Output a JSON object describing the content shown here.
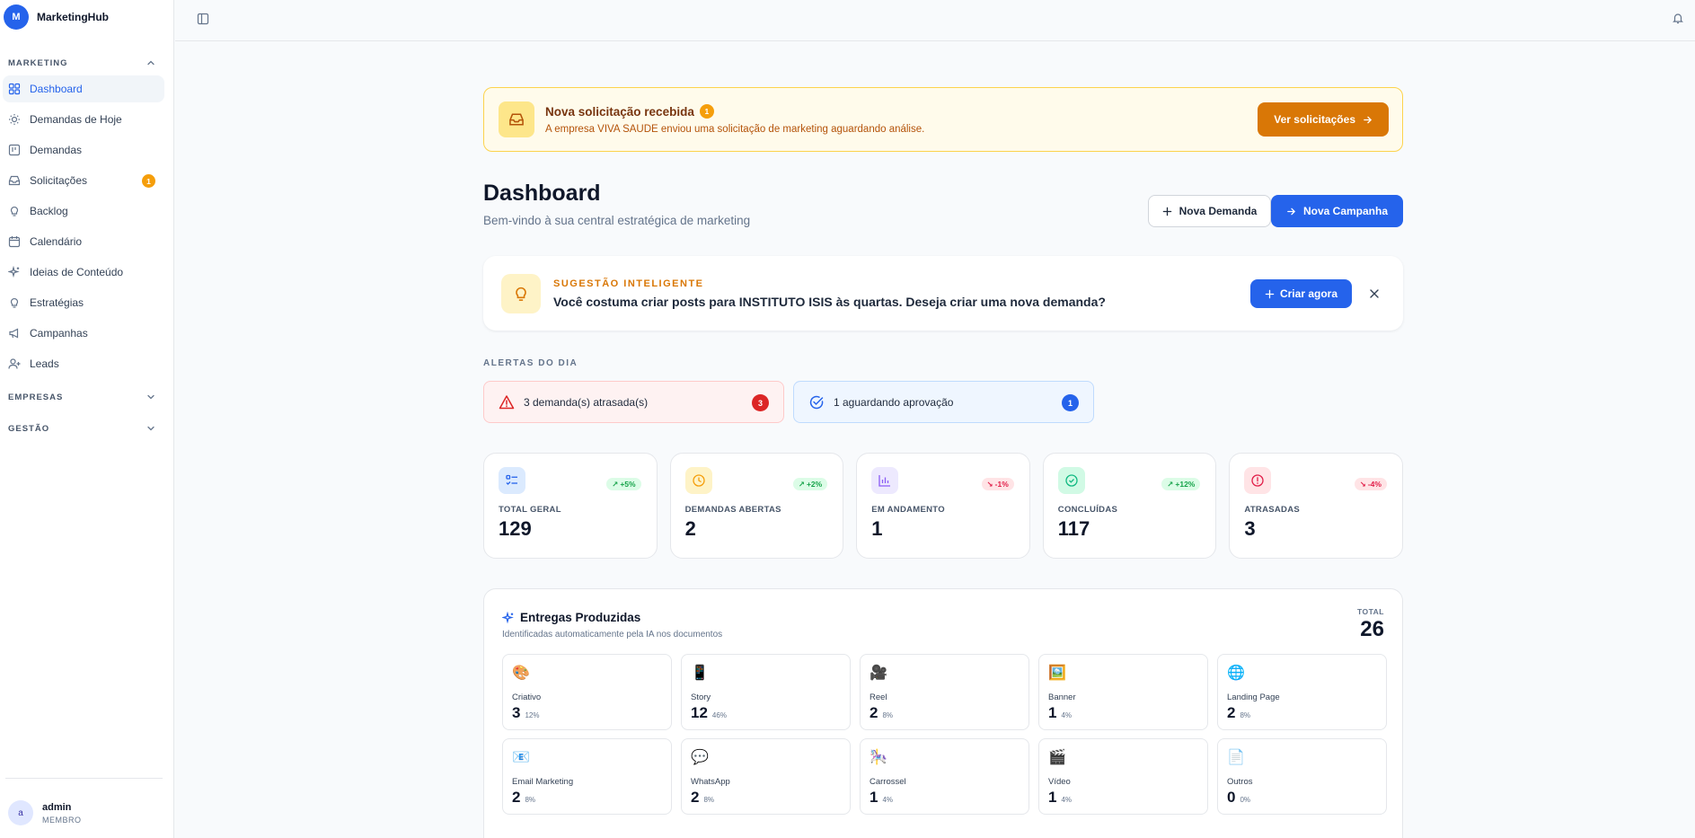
{
  "brand": {
    "logo_letter": "M",
    "name": "MarketingHub"
  },
  "sidebar": {
    "sections": [
      {
        "title": "MARKETING",
        "expanded": true
      },
      {
        "title": "EMPRESAS",
        "expanded": false
      },
      {
        "title": "GESTÃO",
        "expanded": false
      }
    ],
    "items": [
      {
        "label": "Dashboard",
        "icon": "grid-icon",
        "active": true
      },
      {
        "label": "Demandas de Hoje",
        "icon": "sun-icon"
      },
      {
        "label": "Demandas",
        "icon": "columns-icon"
      },
      {
        "label": "Solicitações",
        "icon": "inbox-icon",
        "badge": "1"
      },
      {
        "label": "Backlog",
        "icon": "lightbulb-icon"
      },
      {
        "label": "Calendário",
        "icon": "calendar-icon"
      },
      {
        "label": "Ideias de Conteúdo",
        "icon": "sparkles-icon"
      },
      {
        "label": "Estratégias",
        "icon": "lightbulb-icon"
      },
      {
        "label": "Campanhas",
        "icon": "megaphone-icon"
      },
      {
        "label": "Leads",
        "icon": "user-plus-icon"
      }
    ],
    "user": {
      "avatar_letter": "a",
      "name": "admin",
      "role": "MEMBRO"
    }
  },
  "banner": {
    "title": "Nova solicitação recebida",
    "count": "1",
    "message": "A empresa VIVA SAUDE enviou uma solicitação de marketing aguardando análise.",
    "button": "Ver solicitações"
  },
  "header": {
    "title": "Dashboard",
    "subtitle": "Bem-vindo à sua central estratégica de marketing",
    "new_demand": "Nova Demanda",
    "new_campaign": "Nova Campanha"
  },
  "suggestion": {
    "label": "SUGESTÃO INTELIGENTE",
    "message": "Você costuma criar posts para INSTITUTO ISIS às quartas. Deseja criar uma nova demanda?",
    "button": "Criar agora"
  },
  "alerts": {
    "title": "ALERTAS DO DIA",
    "items": [
      {
        "text": "3 demanda(s) atrasada(s)",
        "count": "3",
        "type": "red"
      },
      {
        "text": "1 aguardando aprovação",
        "count": "1",
        "type": "blue"
      }
    ]
  },
  "stats": [
    {
      "label": "TOTAL GERAL",
      "value": "129",
      "trend": "+5%",
      "direction": "up",
      "color": "#2563eb",
      "bg": "#dbeafe",
      "icon": "list-check-icon"
    },
    {
      "label": "DEMANDAS ABERTAS",
      "value": "2",
      "trend": "+2%",
      "direction": "up",
      "color": "#f59e0b",
      "bg": "#fef3c7",
      "icon": "clock-icon"
    },
    {
      "label": "EM ANDAMENTO",
      "value": "1",
      "trend": "-1%",
      "direction": "down",
      "color": "#8b5cf6",
      "bg": "#ede9fe",
      "icon": "bar-chart-icon"
    },
    {
      "label": "CONCLUÍDAS",
      "value": "117",
      "trend": "+12%",
      "direction": "up",
      "color": "#10b981",
      "bg": "#d1fae5",
      "icon": "check-circle-icon"
    },
    {
      "label": "ATRASADAS",
      "value": "3",
      "trend": "-4%",
      "direction": "down",
      "color": "#e11d48",
      "bg": "#ffe4e6",
      "icon": "alert-circle-icon"
    }
  ],
  "deliveries": {
    "title": "Entregas Produzidas",
    "subtitle": "Identificadas automaticamente pela IA nos documentos",
    "total_label": "TOTAL",
    "total": "26",
    "items": [
      {
        "label": "Criativo",
        "value": "3",
        "pct": "12%",
        "emoji": "🎨"
      },
      {
        "label": "Story",
        "value": "12",
        "pct": "46%",
        "emoji": "📱"
      },
      {
        "label": "Reel",
        "value": "2",
        "pct": "8%",
        "emoji": "🎥"
      },
      {
        "label": "Banner",
        "value": "1",
        "pct": "4%",
        "emoji": "🖼️"
      },
      {
        "label": "Landing Page",
        "value": "2",
        "pct": "8%",
        "emoji": "🌐"
      },
      {
        "label": "Email Marketing",
        "value": "2",
        "pct": "8%",
        "emoji": "📧"
      },
      {
        "label": "WhatsApp",
        "value": "2",
        "pct": "8%",
        "emoji": "💬"
      },
      {
        "label": "Carrossel",
        "value": "1",
        "pct": "4%",
        "emoji": "🎠"
      },
      {
        "label": "Vídeo",
        "value": "1",
        "pct": "4%",
        "emoji": "🎬"
      },
      {
        "label": "Outros",
        "value": "0",
        "pct": "0%",
        "emoji": "📄"
      }
    ]
  }
}
